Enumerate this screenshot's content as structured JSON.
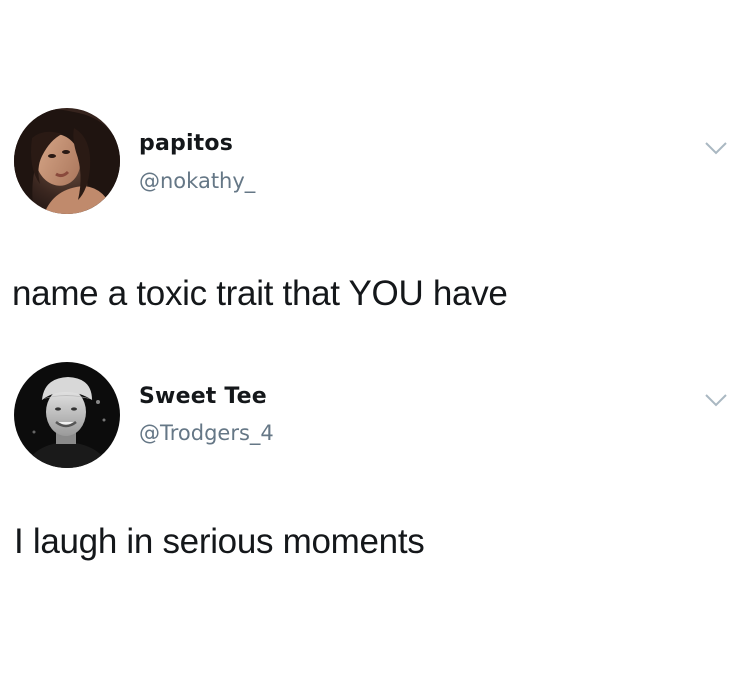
{
  "tweets": [
    {
      "display_name": "papitos",
      "handle": "@nokathy_",
      "text": "name a toxic trait that YOU have",
      "avatar_icon": "avatar-photo-woman",
      "menu_icon": "chevron-down-icon"
    },
    {
      "display_name": "Sweet Tee",
      "handle": "@Trodgers_4",
      "text": "I laugh in serious moments",
      "avatar_icon": "avatar-photo-man-cap",
      "menu_icon": "chevron-down-icon"
    }
  ],
  "colors": {
    "background": "#ffffff",
    "text": "#14171a",
    "secondary_text": "#657786",
    "chevron": "#aab8c2"
  }
}
